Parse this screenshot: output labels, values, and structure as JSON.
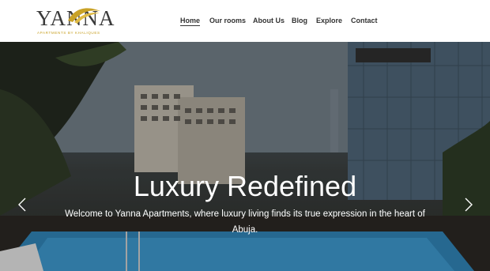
{
  "brand": {
    "name": "YANNA",
    "tagline": "APARTMENTS BY KHALIQUES",
    "accent_color": "#c9a227"
  },
  "nav": {
    "items": [
      {
        "label": "Home",
        "active": true
      },
      {
        "label": "Our rooms",
        "active": false
      },
      {
        "label": "About Us",
        "active": false
      },
      {
        "label": "Blog",
        "active": false
      },
      {
        "label": "Explore",
        "active": false
      },
      {
        "label": "Contact",
        "active": false
      }
    ]
  },
  "hero": {
    "title": "Luxury Redefined",
    "subtitle": "Welcome to Yanna Apartments, where luxury living finds its true expression in the heart of Abuja.",
    "prev_icon": "chevron-left-icon",
    "next_icon": "chevron-right-icon"
  }
}
